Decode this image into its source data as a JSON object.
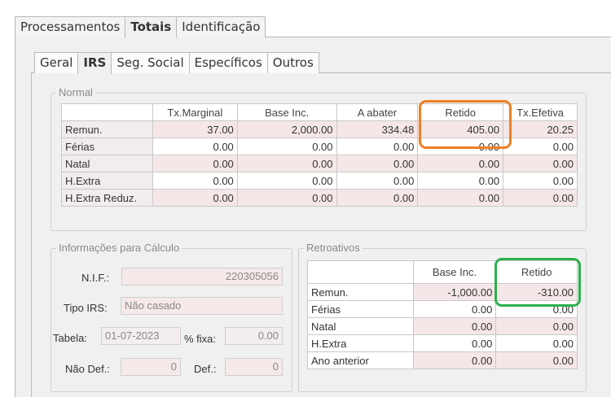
{
  "outer_tabs": [
    {
      "label": "Processamentos"
    },
    {
      "label": "Totais"
    },
    {
      "label": "Identificação"
    }
  ],
  "inner_tabs": [
    {
      "label": "Geral"
    },
    {
      "label": "IRS"
    },
    {
      "label": "Seg. Social"
    },
    {
      "label": "Específicos"
    },
    {
      "label": "Outros"
    }
  ],
  "normal": {
    "title": "Normal",
    "columns": [
      "Tx.Marginal",
      "Base Inc.",
      "A abater",
      "Retido",
      "Tx.Efetiva"
    ],
    "rows": [
      {
        "label": "Remun.",
        "values": [
          "37.00",
          "2,000.00",
          "334.48",
          "405.00",
          "20.25"
        ]
      },
      {
        "label": "Férias",
        "values": [
          "0.00",
          "0.00",
          "0.00",
          "0.00",
          "0.00"
        ]
      },
      {
        "label": "Natal",
        "values": [
          "0.00",
          "0.00",
          "0.00",
          "0.00",
          "0.00"
        ]
      },
      {
        "label": "H.Extra",
        "values": [
          "0.00",
          "0.00",
          "0.00",
          "0.00",
          "0.00"
        ]
      },
      {
        "label": "H.Extra Reduz.",
        "values": [
          "0.00",
          "0.00",
          "0.00",
          "0.00",
          "0.00"
        ]
      }
    ]
  },
  "calc": {
    "title": "Informações para Cálculo",
    "nif_label": "N.I.F.:",
    "nif_value": "220305056",
    "tipo_label": "Tipo IRS:",
    "tipo_value": "Não casado",
    "tabela_label": "Tabela:",
    "tabela_value": "01-07-2023",
    "fixa_label": "% fixa:",
    "fixa_value": "0.00",
    "naodef_label": "Não Def.:",
    "naodef_value": "0",
    "def_label": "Def.:",
    "def_value": "0"
  },
  "retro": {
    "title": "Retroativos",
    "columns": [
      "Base Inc.",
      "Retido"
    ],
    "rows": [
      {
        "label": "Remun.",
        "values": [
          "-1,000.00",
          "-310.00"
        ]
      },
      {
        "label": "Férias",
        "values": [
          "0.00",
          "0.00"
        ]
      },
      {
        "label": "Natal",
        "values": [
          "0.00",
          "0.00"
        ]
      },
      {
        "label": "H.Extra",
        "values": [
          "0.00",
          "0.00"
        ]
      },
      {
        "label": "Ano anterior",
        "values": [
          "0.00",
          "0.00"
        ]
      }
    ]
  },
  "highlight_colors": {
    "orange": "#f07f22",
    "green": "#2bb24c"
  }
}
